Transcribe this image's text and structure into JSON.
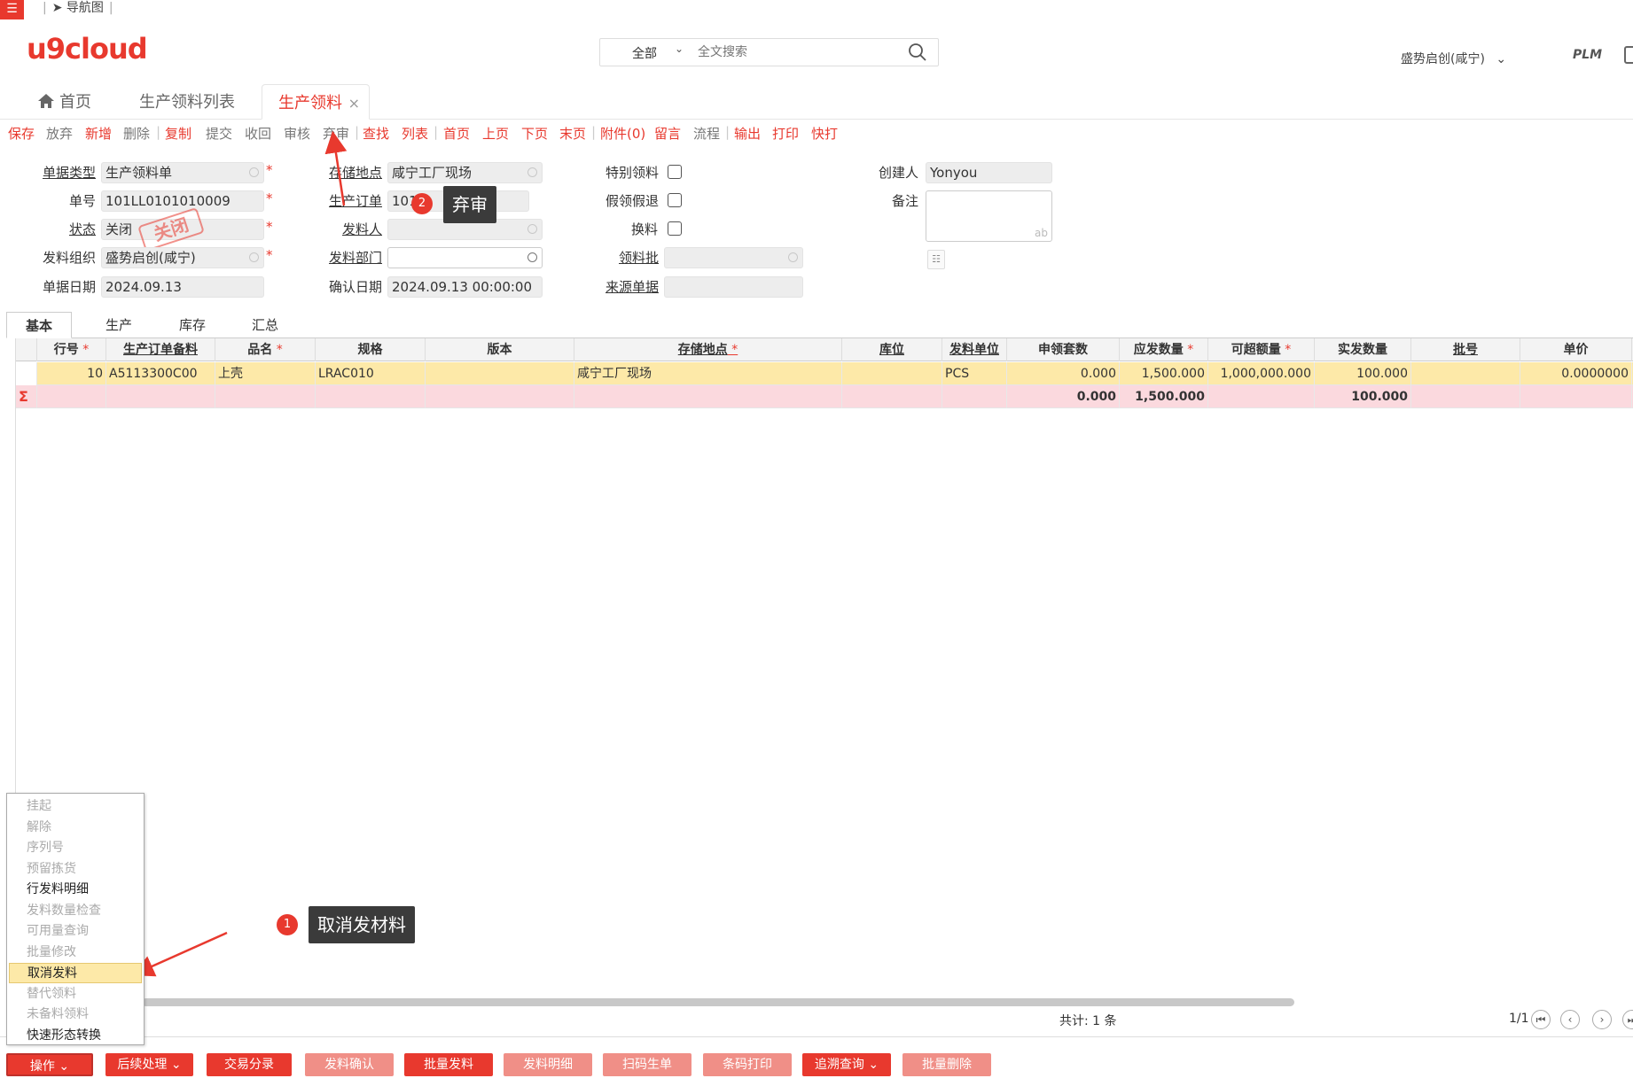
{
  "topbar": {
    "nav_map": "导航图"
  },
  "header": {
    "logo": "u9cloud",
    "search_scope": "全部",
    "search_placeholder": "全文搜索",
    "org": "盛势启创(咸宁)",
    "plm": "PLM"
  },
  "tabs": {
    "home": "首页",
    "list": "生产领料列表",
    "active": "生产领料",
    "close": "×"
  },
  "toolbar": {
    "items": [
      {
        "label": "保存",
        "color": "red"
      },
      {
        "label": "放弃",
        "color": "gray"
      },
      {
        "label": "新增",
        "color": "red"
      },
      {
        "label": "删除",
        "color": "gray"
      },
      {
        "label": "复制",
        "color": "red"
      },
      {
        "label": "提交",
        "color": "gray"
      },
      {
        "label": "收回",
        "color": "gray"
      },
      {
        "label": "审核",
        "color": "gray"
      },
      {
        "label": "弃审",
        "color": "gray"
      },
      {
        "label": "查找",
        "color": "red"
      },
      {
        "label": "列表",
        "color": "red"
      },
      {
        "label": "首页",
        "color": "red"
      },
      {
        "label": "上页",
        "color": "red"
      },
      {
        "label": "下页",
        "color": "red"
      },
      {
        "label": "末页",
        "color": "red"
      },
      {
        "label": "附件(0)",
        "color": "red"
      },
      {
        "label": "留言",
        "color": "red"
      },
      {
        "label": "流程",
        "color": "gray"
      },
      {
        "label": "输出",
        "color": "red"
      },
      {
        "label": "打印",
        "color": "red"
      },
      {
        "label": "快打",
        "color": "red"
      }
    ]
  },
  "form": {
    "doc_type_label": "单据类型",
    "doc_type": "生产领料单",
    "doc_no_label": "单号",
    "doc_no": "101LL0101010009",
    "status_label": "状态",
    "status": "关闭",
    "status_stamp": "关闭",
    "issue_org_label": "发料组织",
    "issue_org": "盛势启创(咸宁)",
    "doc_date_label": "单据日期",
    "doc_date": "2024.09.13",
    "storage_label": "存储地点",
    "storage": "咸宁工厂现场",
    "prod_order_label": "生产订单",
    "prod_order": "101",
    "issuer_label": "发料人",
    "issuer": "",
    "issue_dept_label": "发料部门",
    "issue_dept": "",
    "confirm_date_label": "确认日期",
    "confirm_date": "2024.09.13 00:00:00",
    "special_label": "特别领料",
    "fake_return_label": "假领假退",
    "swap_label": "换料",
    "batch_label": "领料批",
    "source_label": "来源单据",
    "creator_label": "创建人",
    "creator": "Yonyou",
    "remark_label": "备注",
    "remark_ab": "ab"
  },
  "subtabs": [
    "基本",
    "生产",
    "库存",
    "汇总"
  ],
  "grid": {
    "columns": [
      "行号",
      "生产订单备料",
      "品名",
      "规格",
      "版本",
      "存储地点",
      "库位",
      "发料单位",
      "申领套数",
      "应发数量",
      "可超额量",
      "实发数量",
      "批号",
      "单价"
    ],
    "row": [
      "10",
      "A5113300C00",
      "上壳",
      "LRAC010",
      "",
      "咸宁工厂现场",
      "",
      "PCS",
      "0.000",
      "1,500.000",
      "1,000,000.000",
      "100.000",
      "",
      "0.0000000"
    ],
    "sum_symbol": "Σ",
    "sum": {
      "apply_sets": "0.000",
      "should_issue": "1,500.000",
      "actual_issue": "100.000"
    }
  },
  "footer": {
    "total": "共计: 1 条",
    "page": "1/1"
  },
  "buttons": [
    {
      "label": "操作",
      "dropdown": true,
      "style": "dark"
    },
    {
      "label": "后续处理",
      "dropdown": true,
      "style": "dark"
    },
    {
      "label": "交易分录",
      "style": "dark"
    },
    {
      "label": "发料确认",
      "style": "light"
    },
    {
      "label": "批量发料",
      "style": "dark"
    },
    {
      "label": "发料明细",
      "style": "light"
    },
    {
      "label": "扫码生单",
      "style": "light"
    },
    {
      "label": "条码打印",
      "style": "light"
    },
    {
      "label": "追溯查询",
      "dropdown": true,
      "style": "dark"
    },
    {
      "label": "批量删除",
      "style": "light"
    }
  ],
  "op_menu": [
    {
      "label": "挂起",
      "enabled": false
    },
    {
      "label": "解除",
      "enabled": false
    },
    {
      "label": "序列号",
      "enabled": false
    },
    {
      "label": "预留拣货",
      "enabled": false
    },
    {
      "label": "行发料明细",
      "enabled": true
    },
    {
      "label": "发料数量检查",
      "enabled": false
    },
    {
      "label": "可用量查询",
      "enabled": false
    },
    {
      "label": "批量修改",
      "enabled": false
    },
    {
      "label": "取消发料",
      "enabled": true,
      "highlighted": true
    },
    {
      "label": "替代领料",
      "enabled": false
    },
    {
      "label": "未备料领料",
      "enabled": false
    },
    {
      "label": "快速形态转换",
      "enabled": true
    }
  ],
  "annotations": {
    "step1_num": "1",
    "step1_text": "取消发材料",
    "step2_num": "2",
    "step2_text": "弃审"
  },
  "colors": {
    "accent": "#e8392e",
    "row_highlight": "#fde9a8",
    "sum_row": "#fbd9de"
  }
}
